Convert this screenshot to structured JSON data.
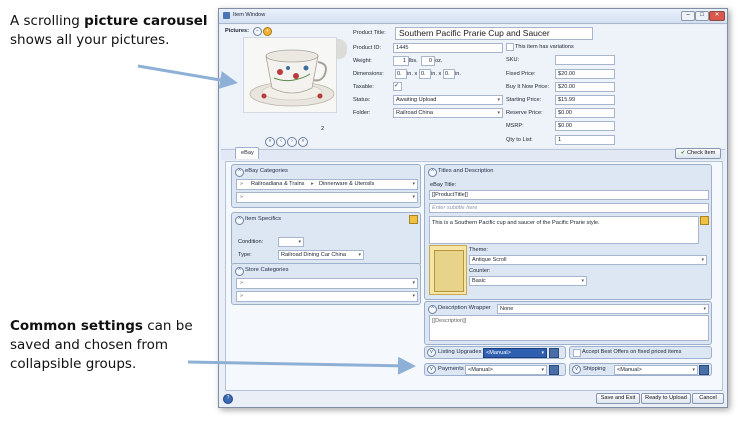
{
  "callouts": {
    "top_line1_pre": "A scrolling ",
    "top_line1_bold": "picture carousel",
    "top_line2": "shows all your pictures.",
    "bottom_line1_bold": "Common settings",
    "bottom_line1_post": " can be",
    "bottom_line2": "saved and chosen from",
    "bottom_line3": "collapsible groups."
  },
  "window": {
    "title": "Item Window",
    "pictures_label": "Pictures:",
    "picture_count": "2",
    "fields": {
      "product_title_label": "Product Title:",
      "product_title": "Southern Pacific Prarie Cup and Saucer",
      "product_id_label": "Product ID:",
      "product_id": "1445",
      "variations_label": "This item has variations",
      "weight_label": "Weight:",
      "weight_lbs": "1",
      "lbs_unit": "lbs.",
      "weight_oz": "0",
      "oz_unit": "oz.",
      "dimensions_label": "Dimensions:",
      "dim1": "0.",
      "dim2": "0.",
      "dim3": "0.",
      "in_x": "in. x",
      "in": "in.",
      "taxable_label": "Taxable:",
      "taxable_check": "✓",
      "status_label": "Status:",
      "status": "Awaiting Upload",
      "folder_label": "Folder:",
      "folder": "Railroad China",
      "sku_label": "SKU:",
      "sku": "",
      "fixed_price_label": "Fixed Price:",
      "fixed_price": "$20.00",
      "buy_it_now_label": "Buy It Now Price:",
      "buy_it_now": "$20.00",
      "starting_price_label": "Starting Price:",
      "starting_price": "$15.99",
      "reserve_price_label": "Reserve Price:",
      "reserve_price": "$0.00",
      "msrp_label": "MSRP:",
      "msrp": "$0.00",
      "qty_label": "Qty to List:",
      "qty": "1"
    },
    "tab_ebay": "eBay",
    "check_item": "Check Item",
    "ebay_categories": {
      "header": "eBay Categories",
      "path1": "Railroadiana & Trains",
      "path2": "Dinnerware & Utensils"
    },
    "item_specifics": {
      "header": "Item Specifics",
      "condition_label": "Condition:",
      "condition": "",
      "type_label": "Type:",
      "type": "Railroad Dining Car China"
    },
    "store_categories": {
      "header": "Store Categories"
    },
    "titles": {
      "header": "Titles and Description",
      "ebay_title_label": "eBay Title:",
      "ebay_title": "[[ProductTitle]]",
      "subtitle_placeholder": "Enter subtitle here",
      "description": "This is a Southern Pacific cup and saucer of the Pacific Prarie style.",
      "theme_label": "Theme:",
      "theme": "Antique Scroll",
      "counter_label": "Counter:",
      "counter": "Basic"
    },
    "description_wrapper": {
      "header": "Description Wrapper",
      "value": "None",
      "content": "[[Description]]"
    },
    "listing_upgrades": {
      "label": "Listing Upgrades",
      "value": "<Manual>"
    },
    "best_offers": "Accept Best Offers on fixed priced items",
    "payments": {
      "label": "Payments",
      "value": "<Manual>"
    },
    "shipping": {
      "label": "Shipping",
      "value": "<Manual>"
    },
    "buttons": {
      "save_exit": "Save and Exit",
      "ready": "Ready to Upload",
      "cancel": "Cancel"
    }
  }
}
